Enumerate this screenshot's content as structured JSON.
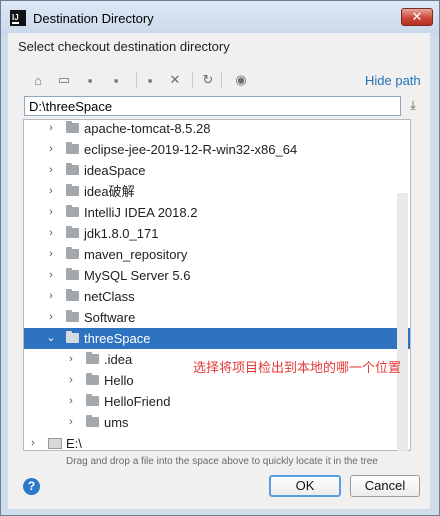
{
  "window": {
    "title": "Destination Directory",
    "app_icon_text": "IJ",
    "close_glyph": "✕"
  },
  "instruction": "Select checkout destination directory",
  "toolbar": {
    "icons": [
      {
        "name": "home-icon",
        "glyph": "⌂"
      },
      {
        "name": "desktop-icon",
        "glyph": "▭"
      },
      {
        "name": "project-icon",
        "glyph": "▪"
      },
      {
        "name": "module-icon",
        "glyph": "▪"
      },
      {
        "name": "new-folder-icon",
        "glyph": "▪"
      },
      {
        "name": "delete-icon",
        "glyph": "✕"
      },
      {
        "name": "refresh-icon",
        "glyph": "↻"
      },
      {
        "name": "show-hidden-icon",
        "glyph": "◉"
      }
    ],
    "hide_path_label": "Hide path"
  },
  "path": {
    "value": "D:\\threeSpace",
    "download_glyph": "⤓"
  },
  "tree": {
    "items": [
      {
        "label": "apache-tomcat-8.5.28",
        "level": 1,
        "arrow": "›",
        "selected": false
      },
      {
        "label": "eclipse-jee-2019-12-R-win32-x86_64",
        "level": 1,
        "arrow": "›",
        "selected": false
      },
      {
        "label": "ideaSpace",
        "level": 1,
        "arrow": "›",
        "selected": false
      },
      {
        "label": "idea破解",
        "level": 1,
        "arrow": "›",
        "selected": false
      },
      {
        "label": "IntelliJ IDEA 2018.2",
        "level": 1,
        "arrow": "›",
        "selected": false
      },
      {
        "label": "jdk1.8.0_171",
        "level": 1,
        "arrow": "›",
        "selected": false
      },
      {
        "label": "maven_repository",
        "level": 1,
        "arrow": "›",
        "selected": false
      },
      {
        "label": "MySQL Server 5.6",
        "level": 1,
        "arrow": "›",
        "selected": false
      },
      {
        "label": "netClass",
        "level": 1,
        "arrow": "›",
        "selected": false
      },
      {
        "label": "Software",
        "level": 1,
        "arrow": "›",
        "selected": false
      },
      {
        "label": "threeSpace",
        "level": 1,
        "arrow": "⌄",
        "selected": true
      },
      {
        "label": ".idea",
        "level": 2,
        "arrow": "›",
        "selected": false
      },
      {
        "label": "Hello",
        "level": 2,
        "arrow": "›",
        "selected": false
      },
      {
        "label": "HelloFriend",
        "level": 2,
        "arrow": "›",
        "selected": false
      },
      {
        "label": "ums",
        "level": 2,
        "arrow": "›",
        "selected": false
      },
      {
        "label": "E:\\",
        "level": 0,
        "arrow": "›",
        "selected": false,
        "drive": true
      }
    ]
  },
  "annotation": "选择将项目检出到本地的哪一个位置",
  "hint": "Drag and drop a file into the space above to quickly locate it in the tree",
  "buttons": {
    "help": "?",
    "ok": "OK",
    "cancel": "Cancel"
  },
  "colors": {
    "selection": "#2e73bf",
    "link": "#2470b3",
    "annotation": "#e53a3a"
  }
}
